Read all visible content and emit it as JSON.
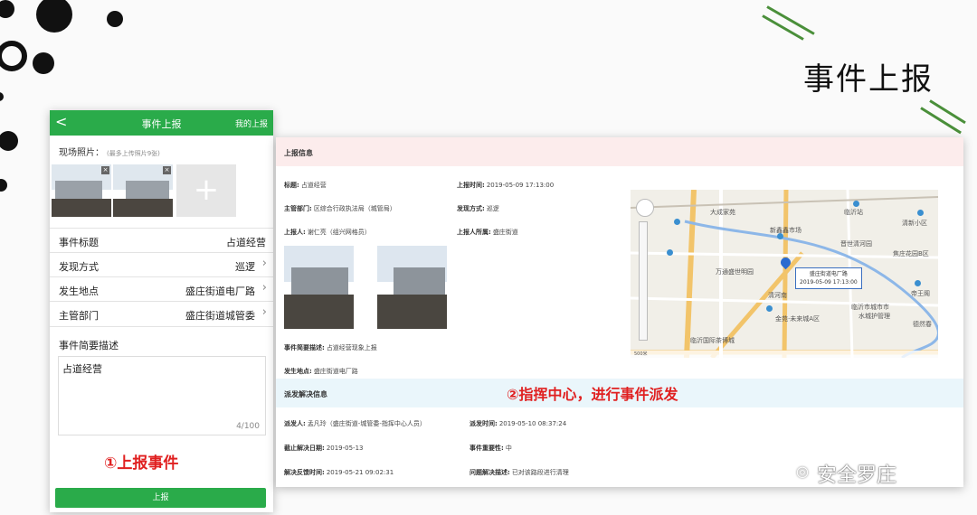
{
  "slide": {
    "title": "事件上报",
    "watermark": "安全罗庄"
  },
  "phone": {
    "header_title": "事件上报",
    "back_glyph": "<",
    "my_reports": "我的上报",
    "photo_label": "现场照片：",
    "photo_hint": "(最多上传照片9张)",
    "add_glyph": "+",
    "remove_glyph": "×",
    "rows": [
      {
        "label": "事件标题",
        "value": "占道经营",
        "arrow": false
      },
      {
        "label": "发现方式",
        "value": "巡逻",
        "arrow": true
      },
      {
        "label": "发生地点",
        "value": "盛庄街道电厂路",
        "arrow": true
      },
      {
        "label": "主管部门",
        "value": "盛庄街道城管委",
        "arrow": true
      }
    ],
    "desc_label": "事件简要描述",
    "desc_value": "占道经营",
    "desc_count": "4/100",
    "step_label": "①上报事件",
    "submit_label": "上报"
  },
  "detail": {
    "report_section": "上报信息",
    "fields": {
      "title_label": "标题:",
      "title_value": "占道经营",
      "time_label": "上报时间:",
      "time_value": "2019-05-09 17:13:00",
      "dept_label": "主管部门:",
      "dept_value": "区综合行政执法局（城管局）",
      "method_label": "发现方式:",
      "method_value": "巡逻",
      "reporter_label": "上报人:",
      "reporter_value": "谢仁亮（组兴网格员）",
      "reporter_office_label": "上报人所属:",
      "reporter_office_value": "盛庄街道",
      "desc_label": "事件简要描述:",
      "desc_value": "占道经营现象上报",
      "place_label": "发生地点:",
      "place_value": "盛庄街道电厂路"
    },
    "dispatch_section": "派发解决信息",
    "step_label": "②指挥中心，进行事件派发",
    "dispatch": {
      "dispatcher_label": "派发人:",
      "dispatcher_value": "孟凡玲（盛庄街道-城管委-指挥中心人员）",
      "dtime_label": "派发时间:",
      "dtime_value": "2019-05-10 08:37:24",
      "deadline_label": "截止解决日期:",
      "deadline_value": "2019-05-13",
      "importance_label": "事件重要性:",
      "importance_value": "中",
      "feedback_label": "解决反馈时间:",
      "feedback_value": "2019-05-21 09:02:31",
      "result_label": "问题解决描述:",
      "result_value": "已对该路段进行清理"
    },
    "map": {
      "popup_place": "盛庄街道电厂路",
      "popup_time": "2019-05-09 17:13:00",
      "labels": [
        "大成家苑",
        "新鑫鑫市场",
        "临沂站",
        "清新小区",
        "晋世清河园",
        "焦庄花园B区",
        "万通盛世明园",
        "清河南",
        "临沂市城市市",
        "水城护管理",
        "帝王阁",
        "金苑·未来城A区",
        "临沂国际茶博城",
        "德然春"
      ],
      "scale": "500米"
    }
  }
}
